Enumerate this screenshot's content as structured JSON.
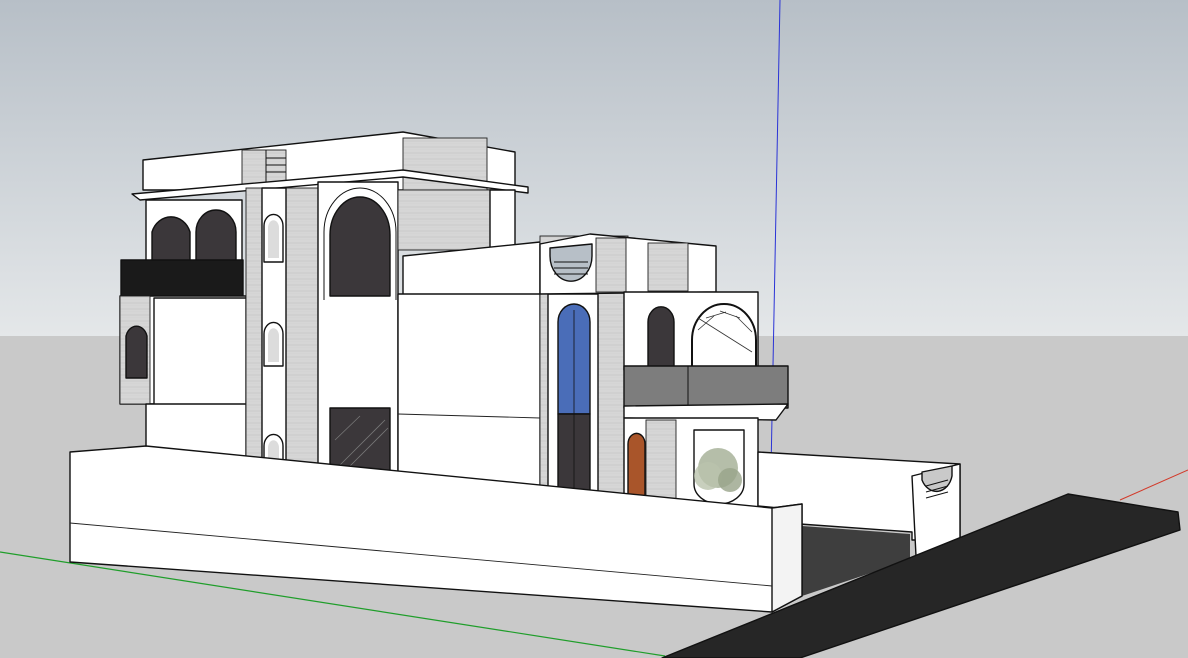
{
  "viewport": {
    "sky_top_color": "#b7bfc7",
    "sky_bottom_color": "#e4e7e9",
    "ground_color": "#c9c9c9",
    "axes": {
      "x_axis_color": "#d23a2a",
      "y_axis_color": "#1f9e2a",
      "z_axis_color": "#2a33d6"
    }
  },
  "model": {
    "wall_color": "#ffffff",
    "stone_cladding_color": "#d6d6d6",
    "glass_dark_color": "#3b373a",
    "glass_blue_color": "#4a6db8",
    "door_wood_color": "#a9552a",
    "road_color": "#262626",
    "railing_glass_color": "#7d7d7d",
    "courtyard_floor_color": "#3e3e3e",
    "tree_color": "#a8b39a"
  }
}
